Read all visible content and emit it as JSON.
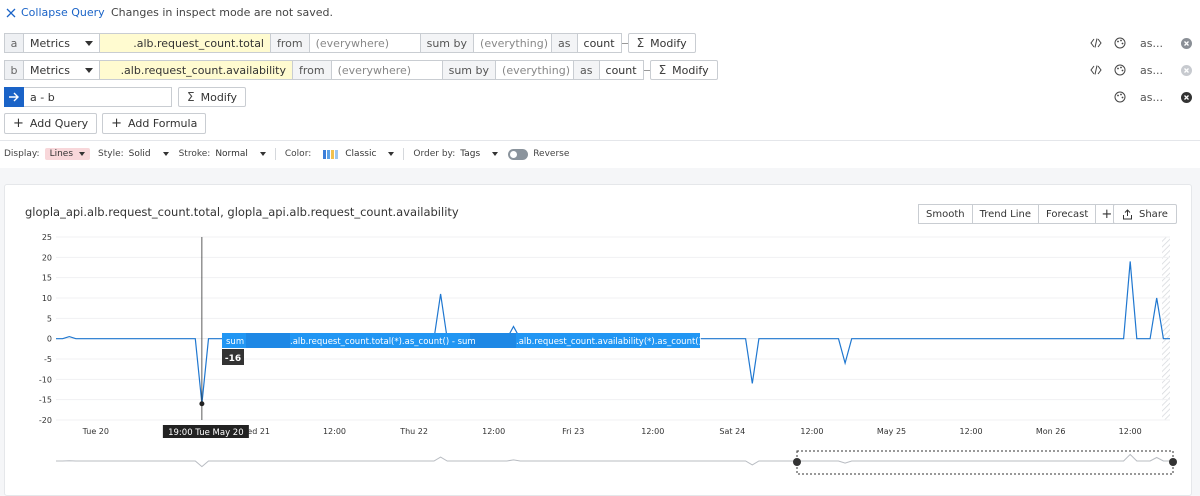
{
  "header": {
    "collapse_label": "Collapse Query",
    "notice": "Changes in inspect mode are not saved."
  },
  "queries": [
    {
      "letter": "a",
      "source": "Metrics",
      "metric": ".alb.request_count.total",
      "from_label": "from",
      "from_value": "(everywhere)",
      "agg_label": "sum by",
      "agg_value": "(everything)",
      "as_label": "as",
      "as_value": "count",
      "modify_label": "Modify",
      "tools_more": "as..."
    },
    {
      "letter": "b",
      "source": "Metrics",
      "metric": ".alb.request_count.availability",
      "from_label": "from",
      "from_value": "(everywhere)",
      "agg_label": "sum by",
      "agg_value": "(everything)",
      "as_label": "as",
      "as_value": "count",
      "modify_label": "Modify",
      "tools_more": "as..."
    }
  ],
  "formula": {
    "expression": "a - b",
    "modify_label": "Modify",
    "tools_more": "as..."
  },
  "add_buttons": {
    "add_query": "Add Query",
    "add_formula": "Add Formula"
  },
  "options": {
    "display_label": "Display:",
    "display_value": "Lines",
    "style_label": "Style:",
    "style_value": "Solid",
    "stroke_label": "Stroke:",
    "stroke_value": "Normal",
    "color_label": "Color:",
    "color_value": "Classic",
    "order_label": "Order by:",
    "order_value": "Tags",
    "reverse_label": "Reverse",
    "palette": [
      "#3b7dd8",
      "#5aa0e6",
      "#f2c14e",
      "#9ec6ef"
    ]
  },
  "chart_toolbar": {
    "smooth": "Smooth",
    "trend": "Trend Line",
    "forecast": "Forecast",
    "add": "+",
    "share": "Share"
  },
  "chart_data": {
    "type": "line",
    "title": "glopla_api.alb.request_count.total, glopla_api.alb.request_count.availability",
    "ylim": [
      -20,
      25
    ],
    "yticks": [
      25,
      20,
      15,
      10,
      5,
      0,
      -5,
      -10,
      -15,
      -20
    ],
    "x_tick_labels": [
      "Tue 20",
      "12:00",
      "Wed 21",
      "12:00",
      "Thu 22",
      "12:00",
      "Fri 23",
      "12:00",
      "Sat 24",
      "12:00",
      "May 25",
      "12:00",
      "Mon 26",
      "12:00"
    ],
    "x_range_hours": [
      0,
      168
    ],
    "x_ticks_hours": [
      6,
      18,
      30,
      42,
      54,
      66,
      78,
      90,
      102,
      114,
      126,
      138,
      150,
      162
    ],
    "grid": true,
    "line_color": "#1f77d0",
    "series": [
      {
        "name": "sum.alb.request_count.total(*).as_count() - sum.alb.request_count.availability(*).as_count()",
        "x": [
          0,
          1,
          2,
          3,
          21,
          22,
          23,
          24,
          25,
          57,
          58,
          59,
          68,
          69,
          70,
          104,
          105,
          106,
          118,
          119,
          120,
          160,
          161,
          162,
          163,
          164,
          165,
          166,
          167,
          168
        ],
        "y": [
          0,
          0,
          0.5,
          0,
          0,
          -16,
          0,
          0,
          0,
          0,
          11,
          0,
          0,
          3,
          0,
          0,
          -11,
          0,
          0,
          -6,
          0,
          0,
          0,
          19,
          0,
          0,
          0,
          10,
          0,
          0
        ]
      }
    ],
    "tooltip": {
      "prefix": "sum",
      "mid": ".alb.request_count.total(*).as_count() - sum",
      "suffix": ".alb.request_count.availability(*).as_count()",
      "value": "-16",
      "time": "19:00 Tue May 20"
    }
  }
}
